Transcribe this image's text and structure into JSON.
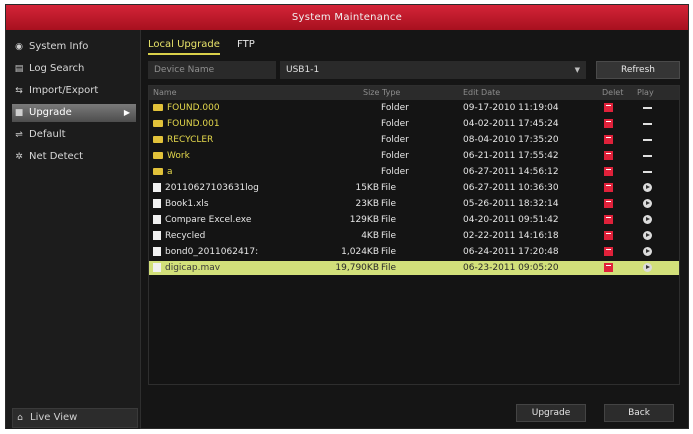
{
  "window": {
    "title": "System Maintenance"
  },
  "sidebar": {
    "items": [
      {
        "label": "System Info",
        "icon": "info-icon",
        "active": false
      },
      {
        "label": "Log Search",
        "icon": "log-icon",
        "active": false
      },
      {
        "label": "Import/Export",
        "icon": "transfer-icon",
        "active": false
      },
      {
        "label": "Upgrade",
        "icon": "upgrade-icon",
        "active": true
      },
      {
        "label": "Default",
        "icon": "default-icon",
        "active": false
      },
      {
        "label": "Net Detect",
        "icon": "network-icon",
        "active": false
      }
    ],
    "live_view": "Live View"
  },
  "tabs": [
    {
      "label": "Local Upgrade",
      "active": true
    },
    {
      "label": "FTP",
      "active": false
    }
  ],
  "device": {
    "label": "Device Name",
    "value": "USB1-1",
    "refresh": "Refresh"
  },
  "table": {
    "headers": {
      "name": "Name",
      "size_type": "Size Type",
      "edit_date": "Edit Date",
      "delete": "Delet",
      "play": "Play"
    },
    "rows": [
      {
        "name": "FOUND.000",
        "size": "",
        "type": "Folder",
        "date": "09-17-2010 11:19:04",
        "kind": "folder"
      },
      {
        "name": "FOUND.001",
        "size": "",
        "type": "Folder",
        "date": "04-02-2011 17:45:24",
        "kind": "folder"
      },
      {
        "name": "RECYCLER",
        "size": "",
        "type": "Folder",
        "date": "08-04-2010 17:35:20",
        "kind": "folder"
      },
      {
        "name": "Work",
        "size": "",
        "type": "Folder",
        "date": "06-21-2011 17:55:42",
        "kind": "folder"
      },
      {
        "name": "a",
        "size": "",
        "type": "Folder",
        "date": "06-27-2011 14:56:12",
        "kind": "folder"
      },
      {
        "name": "20110627103631log",
        "size": "15KB",
        "type": "File",
        "date": "06-27-2011 10:36:30",
        "kind": "file"
      },
      {
        "name": "Book1.xls",
        "size": "23KB",
        "type": "File",
        "date": "05-26-2011 18:32:14",
        "kind": "file"
      },
      {
        "name": "Compare Excel.exe",
        "size": "129KB",
        "type": "File",
        "date": "04-20-2011 09:51:42",
        "kind": "file"
      },
      {
        "name": "Recycled",
        "size": "4KB",
        "type": "File",
        "date": "02-22-2011 14:16:18",
        "kind": "file"
      },
      {
        "name": "bond0_2011062417:",
        "size": "1,024KB",
        "type": "File",
        "date": "06-24-2011 17:20:48",
        "kind": "file"
      },
      {
        "name": "digicap.mav",
        "size": "19,790KB",
        "type": "File",
        "date": "06-23-2011 09:05:20",
        "kind": "file",
        "selected": true
      }
    ]
  },
  "buttons": {
    "upgrade": "Upgrade",
    "back": "Back"
  },
  "colors": {
    "title_red": "#c11a2d",
    "folder_yellow": "#e4d84c",
    "selected_row": "#d2e07a",
    "delete_red": "#e0213a"
  }
}
